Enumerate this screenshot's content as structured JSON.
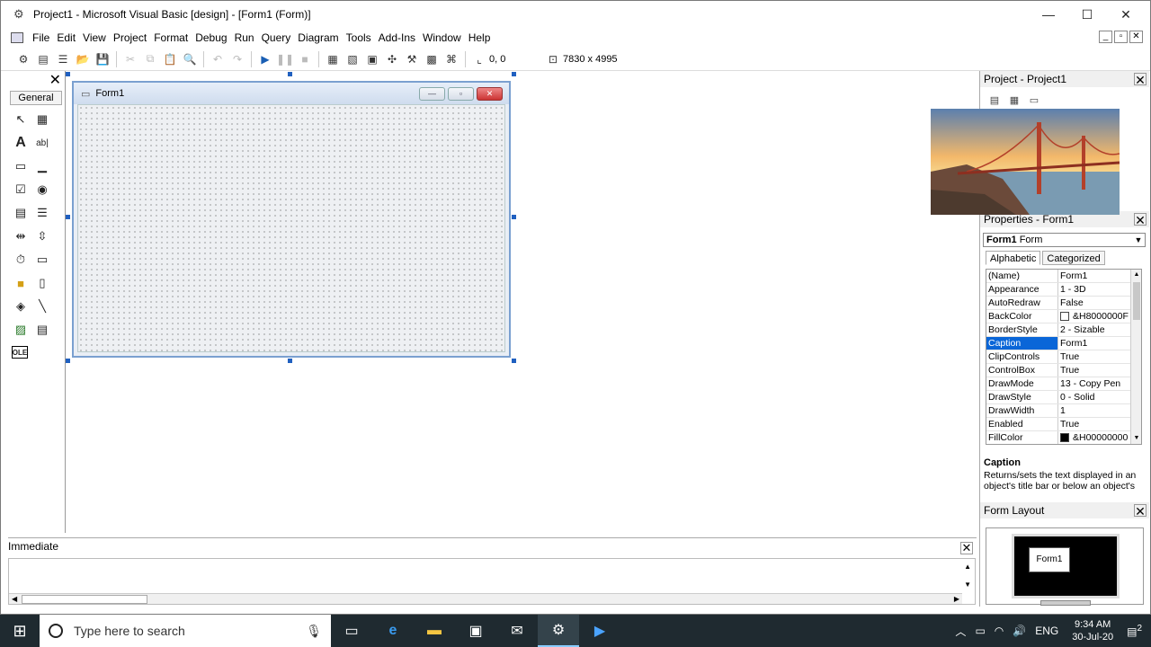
{
  "window": {
    "title": "Project1 - Microsoft Visual Basic [design] - [Form1 (Form)]",
    "controls": {
      "minimize": "—",
      "maximize": "☐",
      "close": "✕"
    }
  },
  "menu": [
    "File",
    "Edit",
    "View",
    "Project",
    "Format",
    "Debug",
    "Run",
    "Query",
    "Diagram",
    "Tools",
    "Add-Ins",
    "Window",
    "Help"
  ],
  "mdi_controls": {
    "minimize": "_",
    "restore": "▫",
    "close": "✕"
  },
  "toolbar": {
    "position": "0, 0",
    "size": "7830 x 4995"
  },
  "toolbox": {
    "tab": "General",
    "close": "✕"
  },
  "form": {
    "title": "Form1",
    "min": "—",
    "max": "▫",
    "close": "✕"
  },
  "project_panel": {
    "title": "Project - Project1",
    "close": "✕"
  },
  "properties_panel": {
    "title": "Properties - Form1",
    "close": "✕",
    "object_name": "Form1",
    "object_type": "Form",
    "tabs": [
      "Alphabetic",
      "Categorized"
    ],
    "rows": [
      {
        "name": "(Name)",
        "value": "Form1"
      },
      {
        "name": "Appearance",
        "value": "1 - 3D"
      },
      {
        "name": "AutoRedraw",
        "value": "False"
      },
      {
        "name": "BackColor",
        "value": "&H8000000F",
        "swatch": "#ffffff"
      },
      {
        "name": "BorderStyle",
        "value": "2 - Sizable"
      },
      {
        "name": "Caption",
        "value": "Form1",
        "selected": true
      },
      {
        "name": "ClipControls",
        "value": "True"
      },
      {
        "name": "ControlBox",
        "value": "True"
      },
      {
        "name": "DrawMode",
        "value": "13 - Copy Pen"
      },
      {
        "name": "DrawStyle",
        "value": "0 - Solid"
      },
      {
        "name": "DrawWidth",
        "value": "1"
      },
      {
        "name": "Enabled",
        "value": "True"
      },
      {
        "name": "FillColor",
        "value": "&H00000000",
        "swatch": "#000000"
      }
    ],
    "description_title": "Caption",
    "description_text": "Returns/sets the text displayed in an object's title bar or below an object's"
  },
  "form_layout": {
    "title": "Form Layout",
    "close": "✕",
    "form_label": "Form1"
  },
  "immediate": {
    "title": "Immediate",
    "close": "✕"
  },
  "taskbar": {
    "search_placeholder": "Type here to search",
    "language": "ENG",
    "time": "9:34 AM",
    "date": "30-Jul-20",
    "notifications": "2"
  }
}
